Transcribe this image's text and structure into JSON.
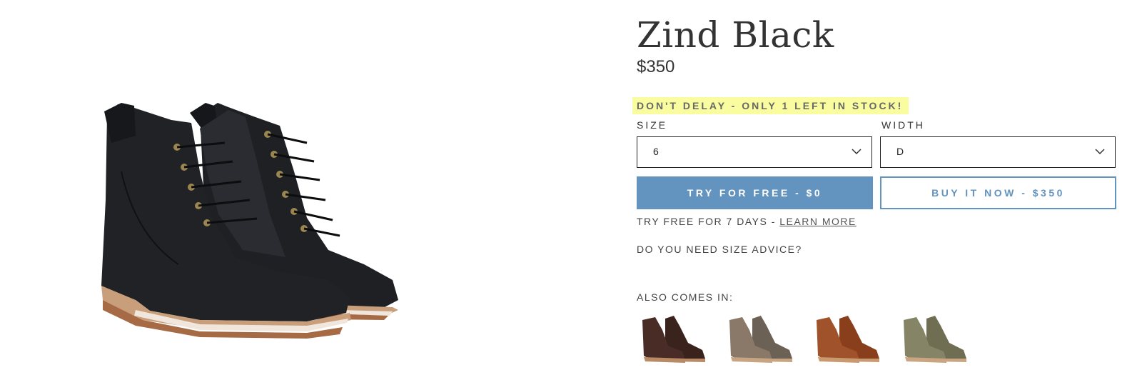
{
  "product": {
    "title": "Zind Black",
    "price": "$350",
    "stock_alert": "DON'T DELAY - ONLY 1 LEFT IN STOCK!",
    "image_icon": "black-lace-up-boot-pair"
  },
  "options": {
    "size": {
      "label": "SIZE",
      "value": "6"
    },
    "width": {
      "label": "WIDTH",
      "value": "D"
    }
  },
  "buttons": {
    "try_label": "TRY FOR FREE - $0",
    "buy_label": "BUY IT NOW - $350"
  },
  "trial": {
    "text": "TRY FREE FOR 7 DAYS - ",
    "link": "LEARN MORE"
  },
  "size_advice": "DO YOU NEED SIZE ADVICE?",
  "also_comes_in": {
    "label": "ALSO COMES IN:",
    "variants": [
      {
        "icon": "dark-brown-boot-swatch",
        "color": "#4a2c26"
      },
      {
        "icon": "taupe-boot-swatch",
        "color": "#857362"
      },
      {
        "icon": "cognac-boot-swatch",
        "color": "#9a4a22"
      },
      {
        "icon": "olive-boot-swatch",
        "color": "#7f7d5d"
      }
    ]
  },
  "colors": {
    "accent": "#6393bf",
    "stock_highlight": "#fafca0",
    "text": "#333333"
  }
}
